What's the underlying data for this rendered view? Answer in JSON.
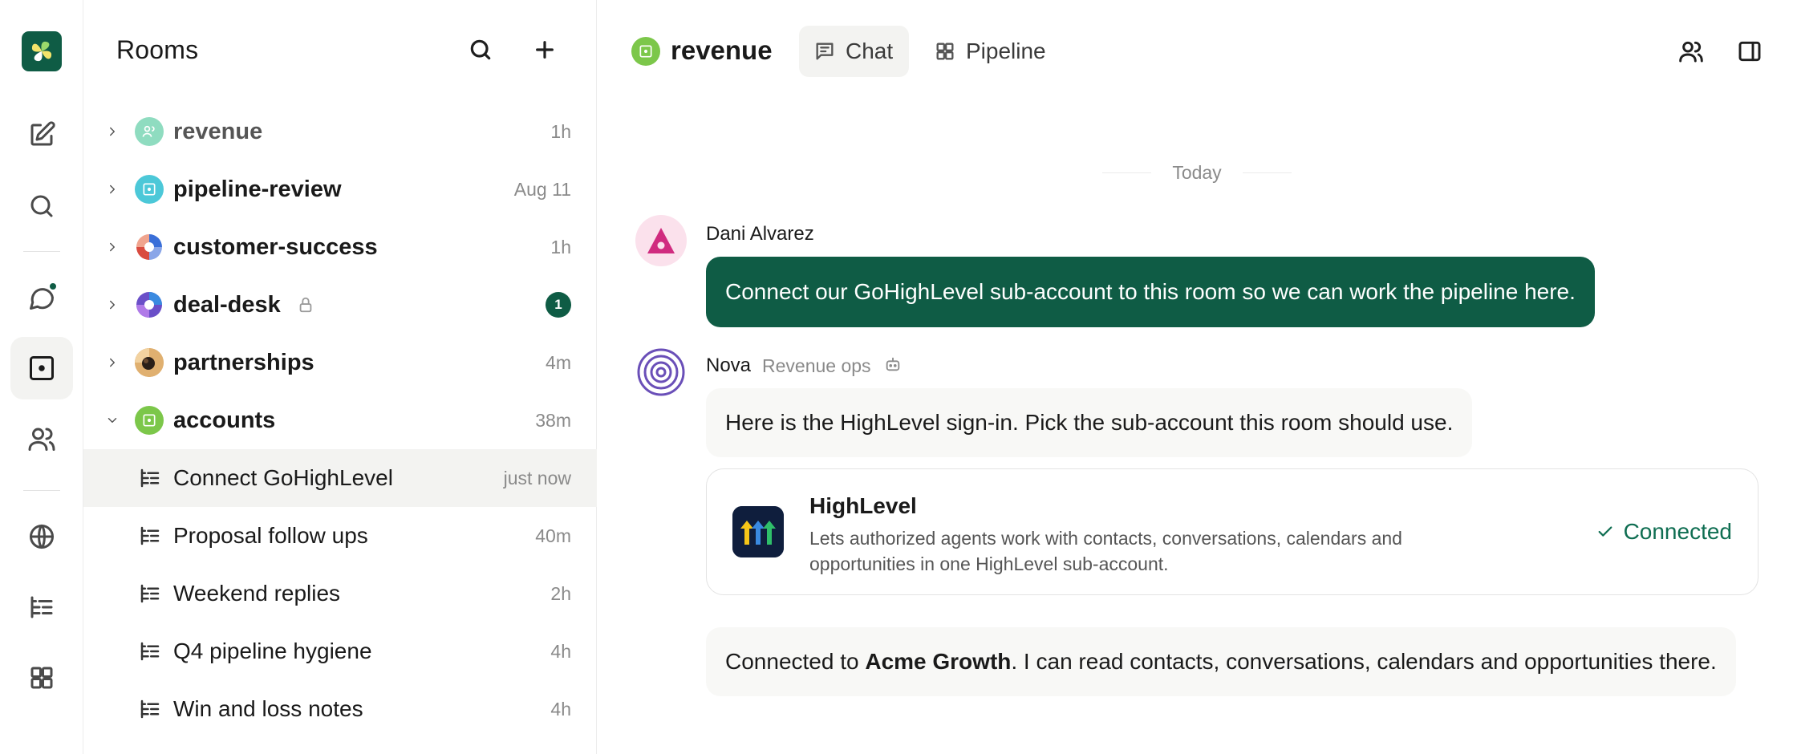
{
  "colors": {
    "brand": "#0f5c45",
    "connected": "#0f6e52",
    "muted_text": "#8a8a8a",
    "bubble_bot": "#f8f8f6"
  },
  "rail": {
    "icons": [
      "app-logo",
      "compose-icon",
      "search-icon",
      "chat-bubble-icon",
      "room-icon",
      "people-icon",
      "globe-icon",
      "threads-icon",
      "grid-icon"
    ]
  },
  "sidebar": {
    "title": "Rooms",
    "rooms": [
      {
        "name": "revenue",
        "meta": "1h"
      },
      {
        "name": "pipeline-review",
        "meta": "Aug 11"
      },
      {
        "name": "customer-success",
        "meta": "1h"
      },
      {
        "name": "deal-desk",
        "badge": "1"
      },
      {
        "name": "partnerships",
        "meta": "4m"
      },
      {
        "name": "accounts",
        "meta": "38m"
      }
    ],
    "threads": [
      {
        "name": "Connect GoHighLevel",
        "meta": "just now"
      },
      {
        "name": "Proposal follow ups",
        "meta": "40m"
      },
      {
        "name": "Weekend replies",
        "meta": "2h"
      },
      {
        "name": "Q4 pipeline hygiene",
        "meta": "4h"
      },
      {
        "name": "Win and loss notes",
        "meta": "4h"
      }
    ]
  },
  "header": {
    "title": "revenue",
    "tabs": [
      {
        "label": "Chat",
        "icon": "chat-icon"
      },
      {
        "label": "Pipeline",
        "icon": "grid-icon"
      }
    ]
  },
  "messages": {
    "day_label": "Today",
    "user": {
      "sender": "Dani Alvarez",
      "text": "Connect our GoHighLevel sub-account to this room so we can work the pipeline here."
    },
    "bot": {
      "sender": "Nova",
      "role": "Revenue ops",
      "text": "Here is the HighLevel sign-in. Pick the sub-account this room should use.",
      "card": {
        "app_name": "HighLevel",
        "description": "Lets authorized agents work with contacts, conversations, calendars and opportunities in one HighLevel sub-account.",
        "status": "Connected"
      },
      "followup": {
        "prefix": "Connected to ",
        "account": "Acme Growth",
        "suffix": ". I can read contacts, conversations, calendars and opportunities there."
      }
    }
  }
}
